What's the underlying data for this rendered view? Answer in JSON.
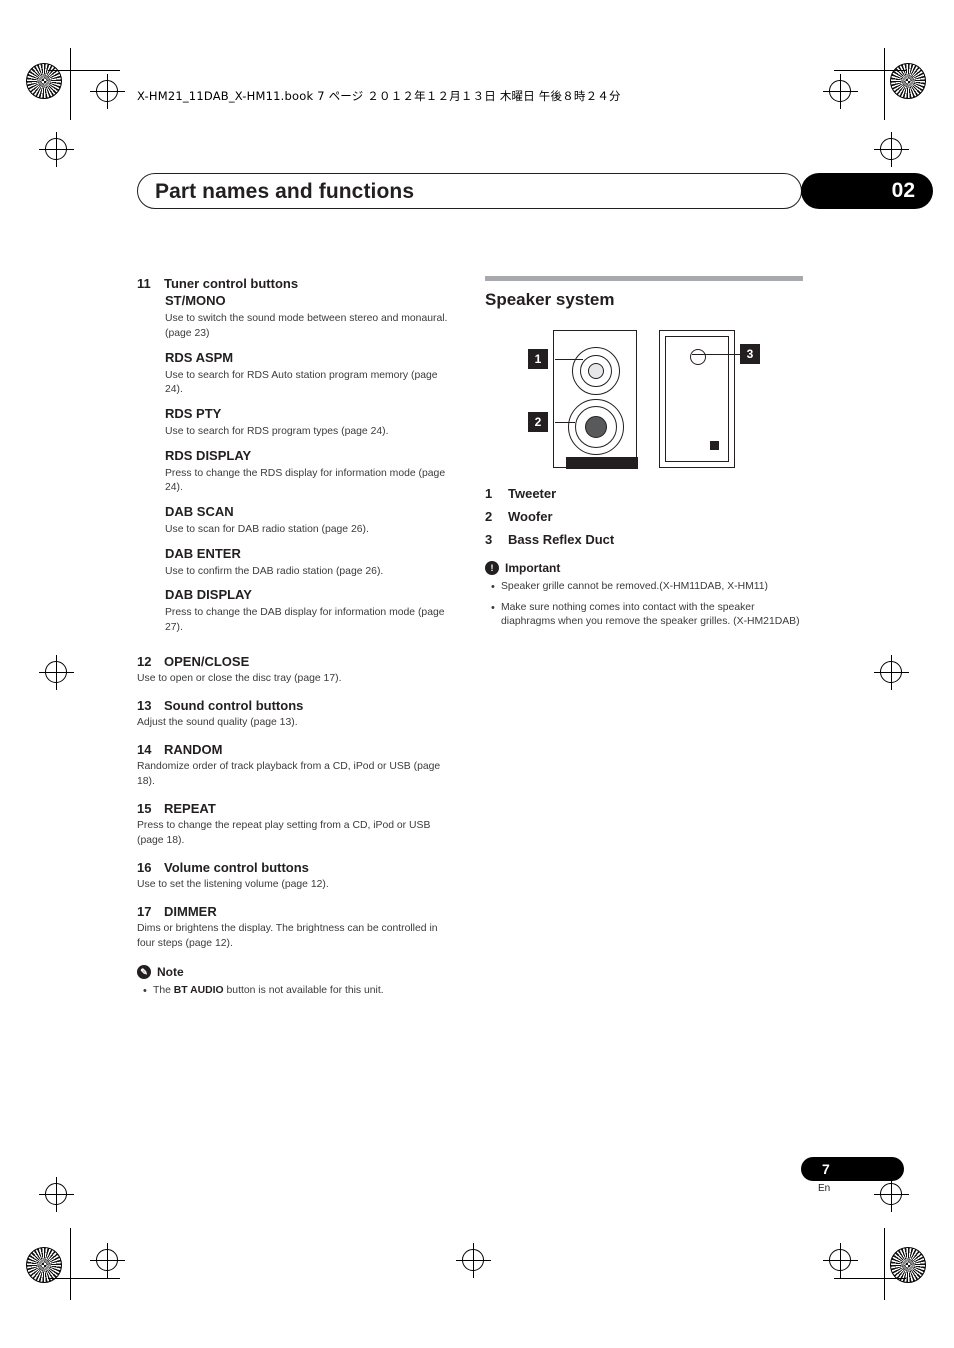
{
  "header": {
    "file_line": "X-HM21_11DAB_X-HM11.book   7 ページ   ２０１２年１２月１３日   木曜日   午後８時２４分"
  },
  "title_bar": {
    "title": "Part names and functions",
    "chapter": "02"
  },
  "left_column": {
    "items": [
      {
        "num": "11",
        "label": "Tuner control buttons",
        "subsections": [
          {
            "name": "ST/MONO",
            "desc": "Use to switch the sound mode between stereo and monaural. (page 23)"
          },
          {
            "name": "RDS ASPM",
            "desc": "Use to search for RDS Auto station program memory (page 24)."
          },
          {
            "name": "RDS PTY",
            "desc": "Use to search for RDS program types (page 24)."
          },
          {
            "name": "RDS DISPLAY",
            "desc": "Press to change the RDS display for information mode (page 24)."
          },
          {
            "name": "DAB SCAN",
            "desc": "Use to scan for DAB radio station (page 26)."
          },
          {
            "name": "DAB ENTER",
            "desc": "Use to confirm the DAB radio station (page 26)."
          },
          {
            "name": "DAB DISPLAY",
            "desc": "Press to change the DAB display for information mode (page 27)."
          }
        ]
      },
      {
        "num": "12",
        "label": "OPEN/CLOSE",
        "desc": "Use to open or close the disc tray (page 17)."
      },
      {
        "num": "13",
        "label": "Sound control buttons",
        "desc": "Adjust the sound quality (page 13)."
      },
      {
        "num": "14",
        "label": "RANDOM",
        "desc": "Randomize order of track playback from a CD, iPod or USB (page 18)."
      },
      {
        "num": "15",
        "label": "REPEAT",
        "desc": "Press to change the repeat play setting from a CD, iPod or USB (page 18)."
      },
      {
        "num": "16",
        "label": "Volume control buttons",
        "desc": "Use to set the listening volume (page 12)."
      },
      {
        "num": "17",
        "label": "DIMMER",
        "desc": "Dims or brightens the display. The brightness can be controlled in four steps (page 12)."
      }
    ],
    "note": {
      "icon": "note-pencil-icon",
      "title": "Note",
      "bullets_pre": [
        "The "
      ],
      "bullets_bold": [
        "BT AUDIO"
      ],
      "bullets_post": [
        " button is not available for this unit."
      ]
    }
  },
  "right_column": {
    "section_title": "Speaker system",
    "diagram": {
      "callouts": [
        "1",
        "2",
        "3"
      ]
    },
    "legend": [
      {
        "num": "1",
        "label": "Tweeter"
      },
      {
        "num": "2",
        "label": "Woofer"
      },
      {
        "num": "3",
        "label": "Bass Reflex Duct"
      }
    ],
    "important": {
      "icon": "important-exclamation-icon",
      "title": "Important",
      "bullets": [
        "Speaker grille cannot be removed.(X-HM11DAB, X-HM11)",
        "Make sure nothing comes into contact with the speaker diaphragms when you remove the speaker grilles. (X-HM21DAB)"
      ]
    }
  },
  "footer": {
    "page_number": "7",
    "language": "En"
  }
}
